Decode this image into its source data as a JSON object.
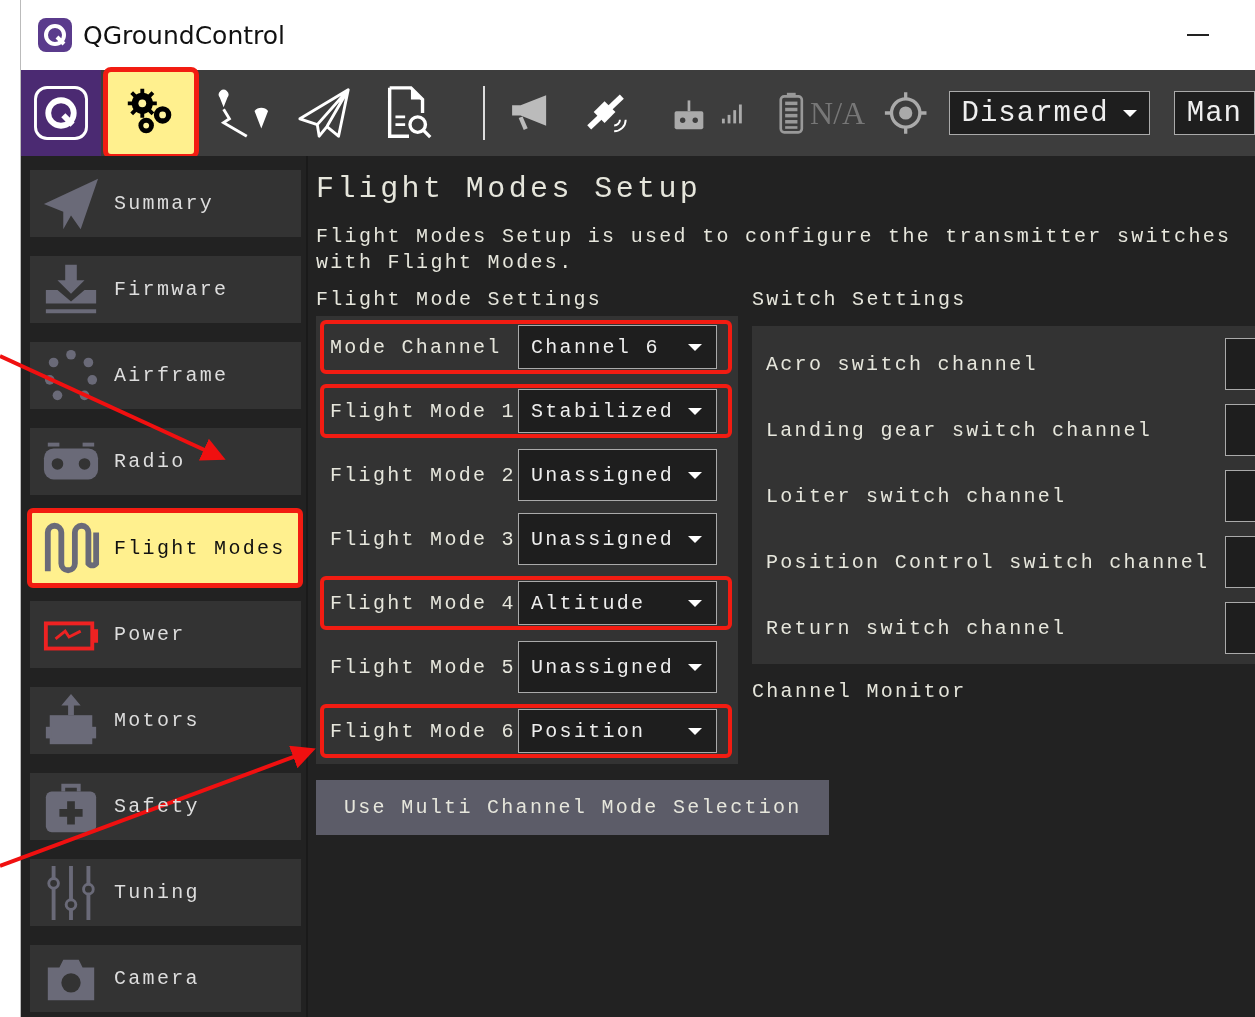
{
  "window": {
    "title": "QGroundControl"
  },
  "toolbar": {
    "views": [
      {
        "kind": "logo",
        "selected": false,
        "highlighted": false
      },
      {
        "kind": "setup",
        "selected": true,
        "highlighted": true
      },
      {
        "kind": "plan",
        "selected": false,
        "highlighted": false
      },
      {
        "kind": "fly",
        "selected": false,
        "highlighted": false
      },
      {
        "kind": "analyze",
        "selected": false,
        "highlighted": false
      }
    ],
    "battery": "N/A",
    "arm_status": "Disarmed",
    "flight_mode": "Man"
  },
  "sidebar": {
    "items": [
      {
        "kind": "summary",
        "label": "Summary",
        "selected": false,
        "highlighted": false
      },
      {
        "kind": "firmware",
        "label": "Firmware",
        "selected": false,
        "highlighted": false
      },
      {
        "kind": "airframe",
        "label": "Airframe",
        "selected": false,
        "highlighted": false
      },
      {
        "kind": "radio",
        "label": "Radio",
        "selected": false,
        "highlighted": false
      },
      {
        "kind": "flight_modes",
        "label": "Flight Modes",
        "selected": true,
        "highlighted": true
      },
      {
        "kind": "power",
        "label": "Power",
        "selected": false,
        "highlighted": false
      },
      {
        "kind": "motors",
        "label": "Motors",
        "selected": false,
        "highlighted": false
      },
      {
        "kind": "safety",
        "label": "Safety",
        "selected": false,
        "highlighted": false
      },
      {
        "kind": "tuning",
        "label": "Tuning",
        "selected": false,
        "highlighted": false
      },
      {
        "kind": "camera",
        "label": "Camera",
        "selected": false,
        "highlighted": false
      }
    ]
  },
  "page": {
    "title": "Flight Modes Setup",
    "description": "Flight Modes Setup is used to configure the transmitter switches with Flight Modes.",
    "mode_settings": {
      "heading": "Flight Mode Settings",
      "rows": [
        {
          "label": "Mode Channel",
          "value": "Channel 6",
          "highlighted": true
        },
        {
          "label": "Flight Mode 1",
          "value": "Stabilized",
          "highlighted": true
        },
        {
          "label": "Flight Mode 2",
          "value": "Unassigned",
          "highlighted": false
        },
        {
          "label": "Flight Mode 3",
          "value": "Unassigned",
          "highlighted": false
        },
        {
          "label": "Flight Mode 4",
          "value": "Altitude",
          "highlighted": true
        },
        {
          "label": "Flight Mode 5",
          "value": "Unassigned",
          "highlighted": false
        },
        {
          "label": "Flight Mode 6",
          "value": "Position",
          "highlighted": true
        }
      ]
    },
    "switch_settings": {
      "heading": "Switch Settings",
      "rows": [
        {
          "label": "Acro switch channel"
        },
        {
          "label": "Landing gear switch channel"
        },
        {
          "label": "Loiter switch channel"
        },
        {
          "label": "Position Control switch channel"
        },
        {
          "label": "Return switch channel"
        }
      ]
    },
    "channel_monitor": {
      "heading": "Channel Monitor"
    },
    "multi_channel_button": "Use Multi Channel Mode Selection"
  }
}
